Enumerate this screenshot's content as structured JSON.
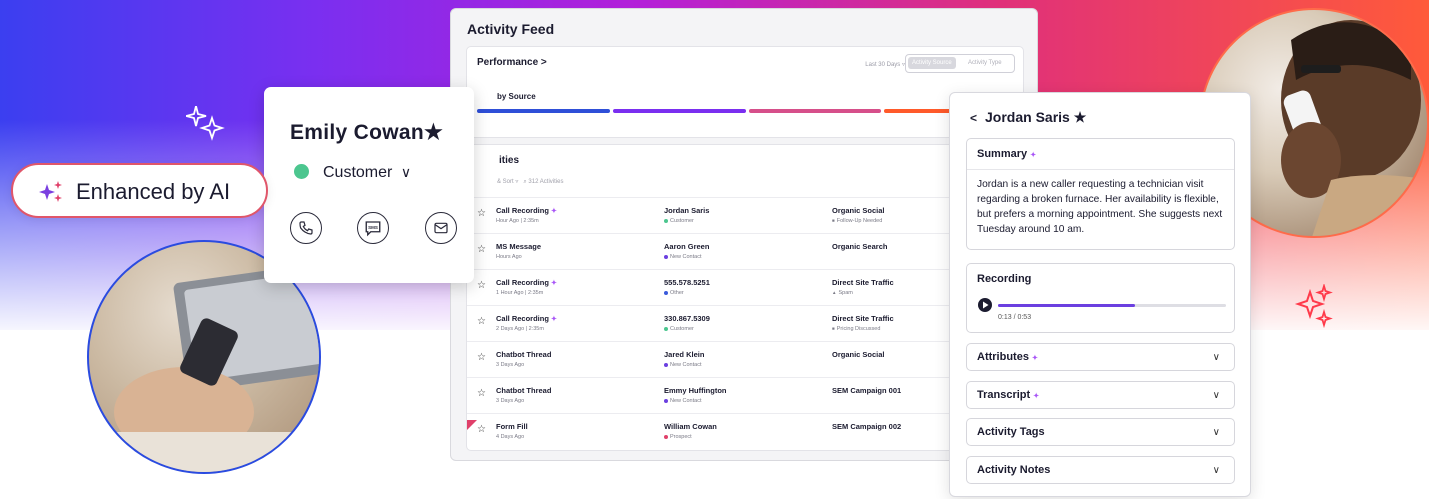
{
  "badge": {
    "label": "Enhanced by AI"
  },
  "feed": {
    "title": "Activity Feed",
    "performance_label": "Performance >",
    "range_label": "Last 30 Days",
    "toggle": [
      "Activity Source",
      "Activity Type"
    ],
    "by_source_label": "by Source",
    "source_bar_colors": [
      "#2f4fd8",
      "#7a2ff0",
      "#d64f8a",
      "#ff5a2a"
    ],
    "activities_title": "ities",
    "sort_label": "& Sort",
    "count_label": "312 Activities",
    "rows": [
      {
        "type": "Call Recording",
        "ai": true,
        "time": "Hour Ago | 2:35m",
        "contact": "Jordan Saris",
        "status": "Customer",
        "status_color": "#4cc68f",
        "source": "Organic Social",
        "tag": "Follow-Up Needed",
        "tag_icon": "■"
      },
      {
        "type": "MS Message",
        "ai": false,
        "time": "Hours Ago",
        "contact": "Aaron Green",
        "status": "New Contact",
        "status_color": "#6b3fe0",
        "source": "Organic Search",
        "tag": "",
        "tag_icon": ""
      },
      {
        "type": "Call Recording",
        "ai": true,
        "time": "1 Hour Ago | 2:35m",
        "contact": "555.578.5251",
        "status": "Other",
        "status_color": "#3b5bdb",
        "source": "Direct Site Traffic",
        "tag": "Spam",
        "tag_icon": "▲"
      },
      {
        "type": "Call Recording",
        "ai": true,
        "time": "2 Days Ago | 2:35m",
        "contact": "330.867.5309",
        "status": "Customer",
        "status_color": "#4cc68f",
        "source": "Direct Site Traffic",
        "tag": "Pricing Discussed",
        "tag_icon": "■"
      },
      {
        "type": "Chatbot Thread",
        "ai": false,
        "time": "3 Days Ago",
        "contact": "Jared Klein",
        "status": "New Contact",
        "status_color": "#6b3fe0",
        "source": "Organic Social",
        "tag": "",
        "tag_icon": ""
      },
      {
        "type": "Chatbot Thread",
        "ai": false,
        "time": "3 Days Ago",
        "contact": "Emmy Huffington",
        "status": "New Contact",
        "status_color": "#6b3fe0",
        "source": "SEM Campaign 001",
        "tag": "",
        "tag_icon": ""
      },
      {
        "type": "Form Fill",
        "ai": false,
        "time": "4 Days Ago",
        "contact": "William Cowan",
        "status": "Prospect",
        "status_color": "#e0406a",
        "source": "SEM Campaign 002",
        "tag": "",
        "tag_icon": ""
      }
    ]
  },
  "contact_card": {
    "name": "Emily Cowan",
    "status": "Customer",
    "actions": [
      "phone-icon",
      "sms-icon",
      "email-icon"
    ],
    "sms_glyph": "SMS"
  },
  "detail": {
    "back": "<",
    "name": "Jordan Saris",
    "summary_title": "Summary",
    "summary_text": "Jordan is a new caller requesting a technician visit regarding a broken furnace. Her availability is flexible, but prefers a morning appointment. She suggests next Tuesday around 10 am.",
    "recording_title": "Recording",
    "recording_time": "0:13 / 0:53",
    "recording_progress": 0.6,
    "sections": [
      {
        "label": "Attributes",
        "ai": true
      },
      {
        "label": "Transcript",
        "ai": true
      },
      {
        "label": "Activity Tags",
        "ai": false
      },
      {
        "label": "Activity Notes",
        "ai": false
      }
    ]
  },
  "colors": {
    "ai_accent": "#a855f7",
    "badge_border": "#e0566a",
    "left_ring": "#2a4be0",
    "right_ring": "#ff6b4a"
  }
}
